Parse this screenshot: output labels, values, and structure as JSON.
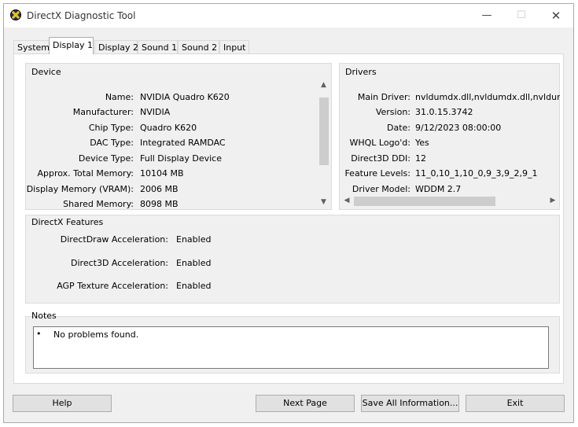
{
  "window": {
    "title": "DirectX Diagnostic Tool"
  },
  "controls": {
    "minimize": "—",
    "maximize": "☐",
    "close": "✕"
  },
  "tabs": [
    {
      "label": "System",
      "active": false
    },
    {
      "label": "Display 1",
      "active": true
    },
    {
      "label": "Display 2",
      "active": false
    },
    {
      "label": "Sound 1",
      "active": false
    },
    {
      "label": "Sound 2",
      "active": false
    },
    {
      "label": "Input",
      "active": false
    }
  ],
  "device": {
    "title": "Device",
    "rows": [
      {
        "label": "Name:",
        "value": "NVIDIA Quadro K620"
      },
      {
        "label": "Manufacturer:",
        "value": "NVIDIA"
      },
      {
        "label": "Chip Type:",
        "value": "Quadro K620"
      },
      {
        "label": "DAC Type:",
        "value": "Integrated RAMDAC"
      },
      {
        "label": "Device Type:",
        "value": "Full Display Device"
      },
      {
        "label": "Approx. Total Memory:",
        "value": "10104 MB"
      },
      {
        "label": "Display Memory (VRAM):",
        "value": "2006 MB"
      },
      {
        "label": "Shared Memory:",
        "value": "8098 MB"
      }
    ]
  },
  "drivers": {
    "title": "Drivers",
    "rows": [
      {
        "label": "Main Driver:",
        "value": "nvldumdx.dll,nvldumdx.dll,nvldumdx.d"
      },
      {
        "label": "Version:",
        "value": "31.0.15.3742"
      },
      {
        "label": "Date:",
        "value": "9/12/2023 08:00:00"
      },
      {
        "label": "WHQL Logo'd:",
        "value": "Yes"
      },
      {
        "label": "Direct3D DDI:",
        "value": "12"
      },
      {
        "label": "Feature Levels:",
        "value": "11_0,10_1,10_0,9_3,9_2,9_1"
      },
      {
        "label": "Driver Model:",
        "value": "WDDM 2.7"
      }
    ]
  },
  "features": {
    "title": "DirectX Features",
    "rows": [
      {
        "label": "DirectDraw Acceleration:",
        "value": "Enabled"
      },
      {
        "label": "Direct3D Acceleration:",
        "value": "Enabled"
      },
      {
        "label": "AGP Texture Acceleration:",
        "value": "Enabled"
      }
    ]
  },
  "notes": {
    "title": "Notes",
    "bullet": "•",
    "items": [
      "No problems found."
    ]
  },
  "scroll_arrows": {
    "up": "▲",
    "down": "▼",
    "left": "◀",
    "right": "▶"
  },
  "buttons": {
    "help": "Help",
    "next": "Next Page",
    "save": "Save All Information...",
    "exit": "Exit"
  }
}
